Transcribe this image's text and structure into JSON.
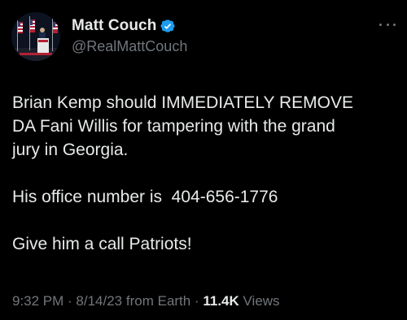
{
  "author": {
    "display_name": "Matt Couch",
    "handle": "@RealMattCouch",
    "verified": true
  },
  "tweet": {
    "lines": [
      "Brian Kemp should IMMEDIATELY REMOVE",
      "DA Fani Willis for tampering with the grand",
      "jury in Georgia.",
      "",
      "His office number is  404-656-1776",
      "",
      "Give him a call Patriots!"
    ]
  },
  "meta": {
    "time": "9:32 PM",
    "sep1": " · ",
    "date": "8/14/23",
    "source": " from Earth",
    "sep2": " · ",
    "views_count": "11.4K",
    "views_label": " Views"
  },
  "icons": {
    "verified": "verified-badge-icon",
    "more": "more-dots-icon"
  },
  "colors": {
    "background": "#000000",
    "text": "#e7e9ea",
    "secondary": "#71767b",
    "verified": "#1d9bf0"
  }
}
